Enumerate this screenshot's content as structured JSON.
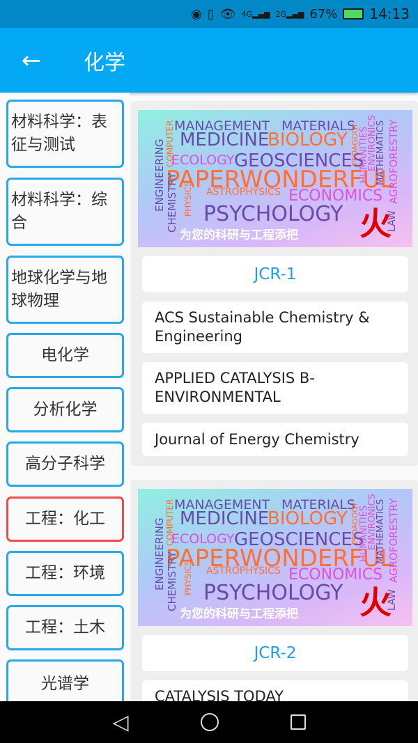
{
  "status_bar": {
    "battery": "67%",
    "time": "14:13",
    "network1": "4G",
    "network2": "2G"
  },
  "app_bar": {
    "title": "化学",
    "back_icon": "arrow-left-icon"
  },
  "categories": [
    {
      "label": "材料科学：表征与测试",
      "selected": false
    },
    {
      "label": "材料科学：综合",
      "selected": false
    },
    {
      "label": "地球化学与地球物理",
      "selected": false
    },
    {
      "label": "电化学",
      "selected": false
    },
    {
      "label": "分析化学",
      "selected": false
    },
    {
      "label": "高分子科学",
      "selected": false
    },
    {
      "label": "工程：化工",
      "selected": true
    },
    {
      "label": "工程：环境",
      "selected": false
    },
    {
      "label": "工程：土木",
      "selected": false
    },
    {
      "label": "光谱学",
      "selected": false
    }
  ],
  "banner": {
    "words": [
      "MANAGEMENT",
      "MATERIALS",
      "MEDICINE",
      "BIOLOGY",
      "ECOLOGY",
      "GEOSCIENCES",
      "PAPERWONDERFUL",
      "ASTROPHYSICS",
      "ECONOMICS",
      "PSYCHOLOGY",
      "ENGINEERING",
      "COMPUTER",
      "CHEMISTRY",
      "PHYSICS",
      "PEDAGOGY",
      "HUMANITIES",
      "ENVIRONICS",
      "MATHEMATICS",
      "AGROFORESTRY",
      "LAW"
    ],
    "slogan": "为您的科研与工程添把",
    "logo": "火"
  },
  "groups": [
    {
      "header": "JCR-1",
      "journals": [
        "ACS Sustainable Chemistry & Engineering",
        "APPLIED CATALYSIS B-ENVIRONMENTAL",
        "Journal of Energy Chemistry"
      ]
    },
    {
      "header": "JCR-2",
      "journals": [
        "CATALYSIS TODAY"
      ]
    }
  ],
  "colors": {
    "primary": "#03a9f4",
    "status": "#0288c6",
    "border": "#29a8e8",
    "selected_border": "#ef4b4b",
    "jcr_text": "#1ea0e8"
  }
}
